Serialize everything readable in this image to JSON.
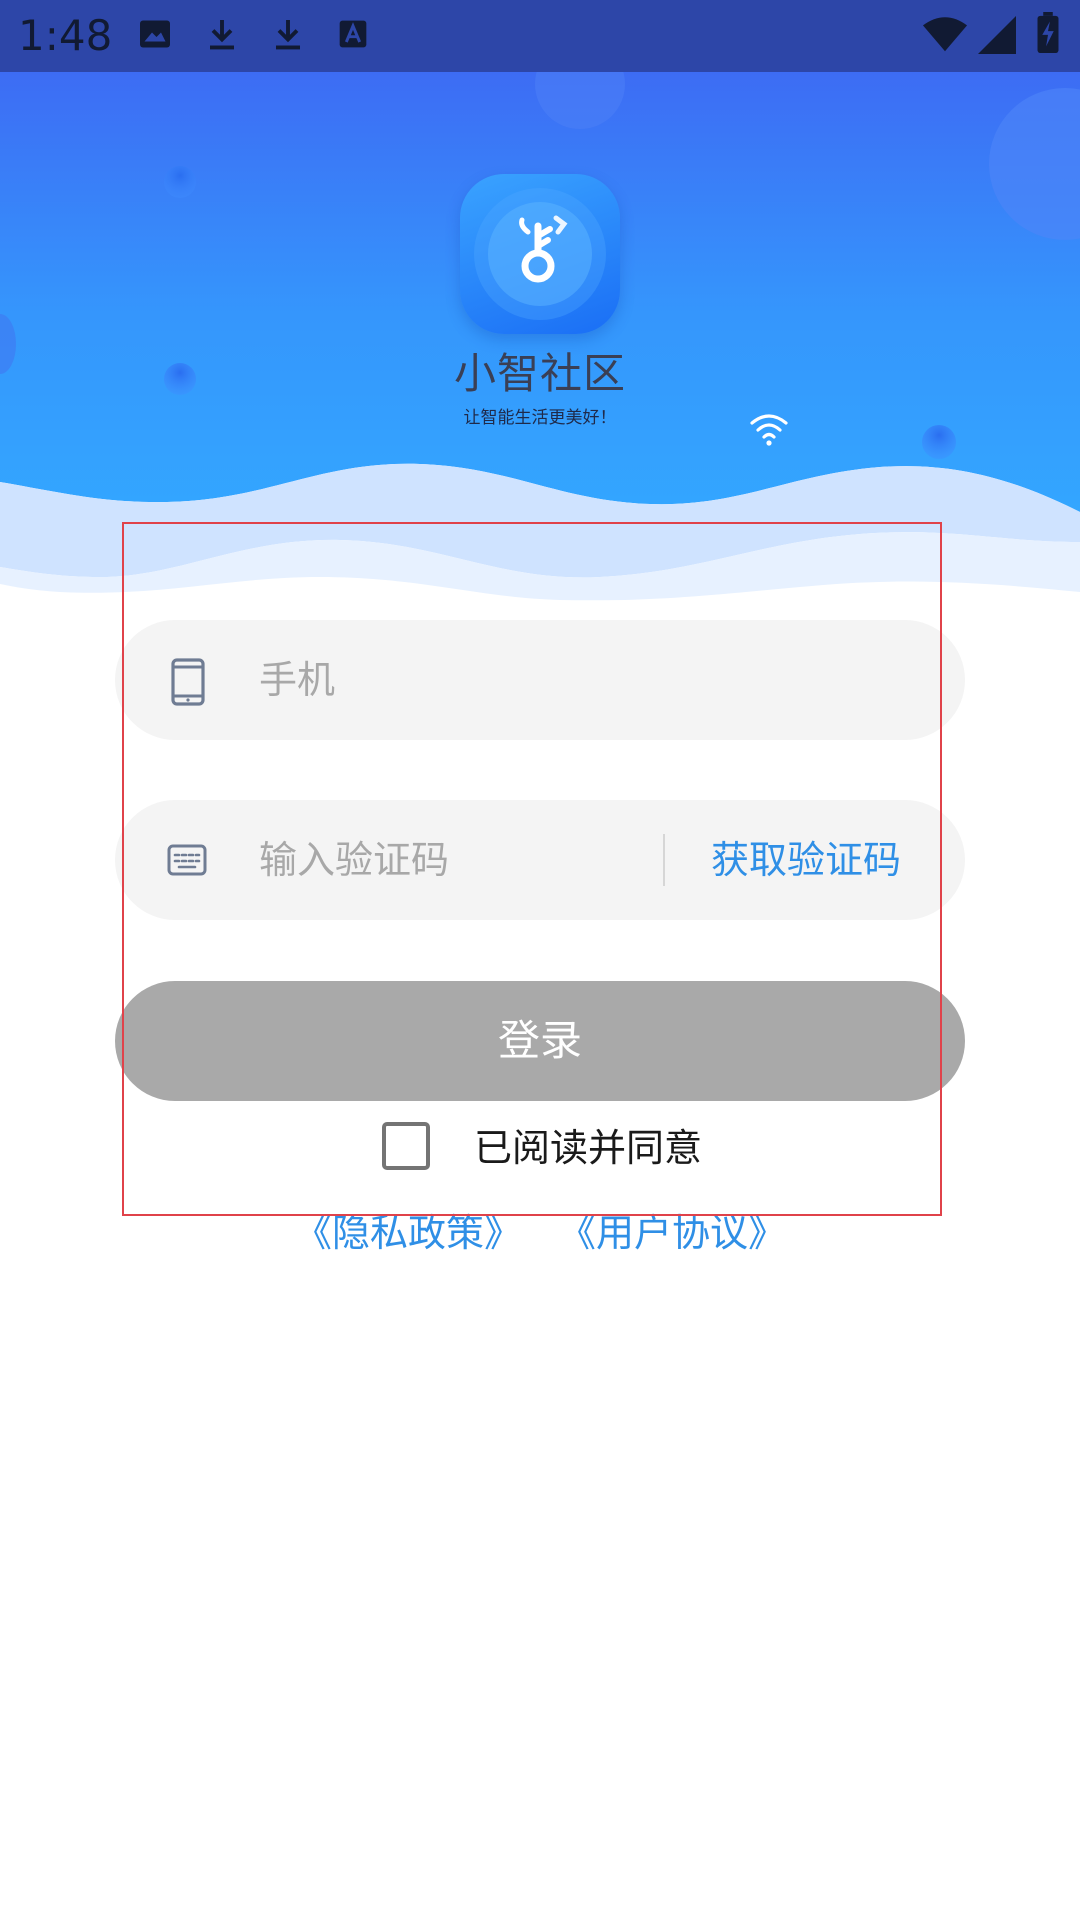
{
  "status_bar": {
    "time": "1:48",
    "icons": [
      "image-icon",
      "download-icon",
      "download-icon",
      "text-a-icon",
      "wifi-icon",
      "signal-icon",
      "battery-charging-icon"
    ]
  },
  "header": {
    "app_name": "小智社区",
    "slogan": "让智能生活更美好！",
    "logo_icon": "key-icon"
  },
  "login_form": {
    "phone": {
      "icon": "smartphone-icon",
      "placeholder": "手机",
      "value": ""
    },
    "verification": {
      "icon": "keyboard-icon",
      "placeholder": "输入验证码",
      "value": "",
      "get_code_label": "获取验证码"
    },
    "login_button_label": "登录",
    "agreement": {
      "checked": false,
      "label": "已阅读并同意"
    },
    "links": {
      "privacy_policy": "《隐私政策》",
      "user_agreement": "《用户协议》"
    }
  },
  "colors": {
    "status_bar": "#2d46a8",
    "header_blue": "#2f8fff",
    "accent_link": "#2f8fe6",
    "login_button_disabled": "#a9a9a9",
    "field_background": "#f4f4f4",
    "highlight_border": "#e0424a"
  }
}
